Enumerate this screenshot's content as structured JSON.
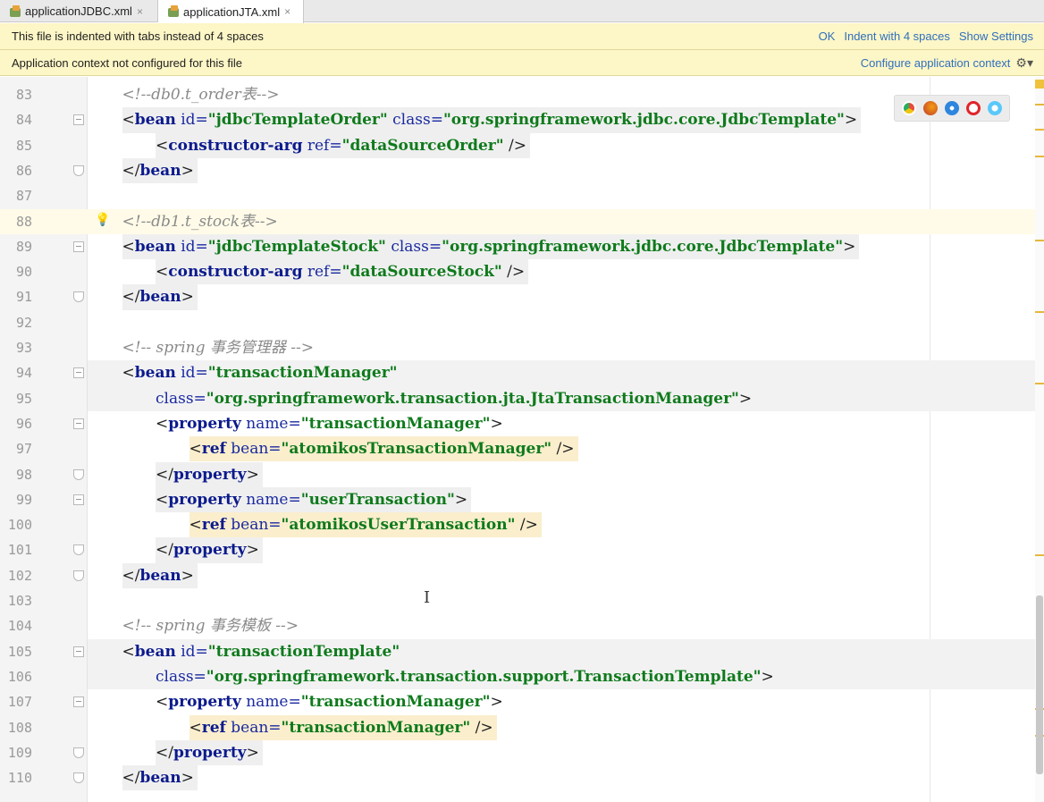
{
  "tabs": [
    {
      "label": "applicationJDBC.xml",
      "close": "×"
    },
    {
      "label": "applicationJTA.xml",
      "close": "×"
    }
  ],
  "banners": {
    "indent": {
      "message": "This file is indented with tabs instead of 4 spaces",
      "ok": "OK",
      "indent": "Indent with 4 spaces",
      "settings": "Show Settings"
    },
    "context": {
      "message": "Application context not configured for this file",
      "configure": "Configure application context",
      "gear": "⚙▾"
    }
  },
  "editor": {
    "lines": [
      {
        "n": "83",
        "tokens": [
          {
            "t": "cmt",
            "v": "<!--db0.t_order表-->"
          }
        ],
        "indent": 1
      },
      {
        "n": "84",
        "tokens": [
          {
            "t": "pun",
            "v": "<"
          },
          {
            "t": "tag",
            "v": "bean"
          },
          {
            "t": "attr",
            "v": " id="
          },
          {
            "t": "val",
            "v": "\"jdbcTemplateOrder\""
          },
          {
            "t": "attr",
            "v": " class="
          },
          {
            "t": "val",
            "v": "\"org.springframework.jdbc.core.JdbcTemplate\""
          },
          {
            "t": "pun",
            "v": ">"
          }
        ],
        "indent": 1,
        "hl": true,
        "fold": "open"
      },
      {
        "n": "85",
        "tokens": [
          {
            "t": "pun",
            "v": "<"
          },
          {
            "t": "tag",
            "v": "constructor-arg"
          },
          {
            "t": "attr",
            "v": " ref="
          },
          {
            "t": "val",
            "v": "\"dataSourceOrder\""
          },
          {
            "t": "pun",
            "v": " />"
          }
        ],
        "indent": 2,
        "hl": true
      },
      {
        "n": "86",
        "tokens": [
          {
            "t": "pun",
            "v": "</"
          },
          {
            "t": "tag",
            "v": "bean"
          },
          {
            "t": "pun",
            "v": ">"
          }
        ],
        "indent": 1,
        "hl": true,
        "fold": "close"
      },
      {
        "n": "87",
        "tokens": [],
        "indent": 1
      },
      {
        "n": "88",
        "tokens": [
          {
            "t": "cmt",
            "v": "<!--db1.t_stock表-->"
          }
        ],
        "indent": 1,
        "caret": true,
        "bulb": "💡"
      },
      {
        "n": "89",
        "tokens": [
          {
            "t": "pun",
            "v": "<"
          },
          {
            "t": "tag",
            "v": "bean"
          },
          {
            "t": "attr",
            "v": " id="
          },
          {
            "t": "val",
            "v": "\"jdbcTemplateStock\""
          },
          {
            "t": "attr",
            "v": " class="
          },
          {
            "t": "val",
            "v": "\"org.springframework.jdbc.core.JdbcTemplate\""
          },
          {
            "t": "pun",
            "v": ">"
          }
        ],
        "indent": 1,
        "hl": true,
        "fold": "open"
      },
      {
        "n": "90",
        "tokens": [
          {
            "t": "pun",
            "v": "<"
          },
          {
            "t": "tag",
            "v": "constructor-arg"
          },
          {
            "t": "attr",
            "v": " ref="
          },
          {
            "t": "val",
            "v": "\"dataSourceStock\""
          },
          {
            "t": "pun",
            "v": " />"
          }
        ],
        "indent": 2,
        "hl": true
      },
      {
        "n": "91",
        "tokens": [
          {
            "t": "pun",
            "v": "</"
          },
          {
            "t": "tag",
            "v": "bean"
          },
          {
            "t": "pun",
            "v": ">"
          }
        ],
        "indent": 1,
        "hl": true,
        "fold": "close"
      },
      {
        "n": "92",
        "tokens": [],
        "indent": 1
      },
      {
        "n": "93",
        "tokens": [
          {
            "t": "cmt",
            "v": "<!-- spring 事务管理器 -->"
          }
        ],
        "indent": 1
      },
      {
        "n": "94",
        "tokens": [
          {
            "t": "pun",
            "v": "<"
          },
          {
            "t": "tag",
            "v": "bean"
          },
          {
            "t": "attr",
            "v": " id="
          },
          {
            "t": "val",
            "v": "\"transactionManager\""
          }
        ],
        "indent": 1,
        "band": true,
        "fold": "open"
      },
      {
        "n": "95",
        "tokens": [
          {
            "t": "attr",
            "v": "class="
          },
          {
            "t": "val",
            "v": "\"org.springframework.transaction.jta.JtaTransactionManager\""
          },
          {
            "t": "pun",
            "v": ">"
          }
        ],
        "indent": 2,
        "band": true
      },
      {
        "n": "96",
        "tokens": [
          {
            "t": "pun",
            "v": "<"
          },
          {
            "t": "tag",
            "v": "property"
          },
          {
            "t": "attr",
            "v": " name="
          },
          {
            "t": "val",
            "v": "\"transactionManager\""
          },
          {
            "t": "pun",
            "v": ">"
          }
        ],
        "indent": 2,
        "fold": "open"
      },
      {
        "n": "97",
        "tokens": [
          {
            "t": "pun",
            "v": "<"
          },
          {
            "t": "tag",
            "v": "ref"
          },
          {
            "t": "attr",
            "v": " bean="
          },
          {
            "t": "val",
            "v": "\"atomikosTransactionManager\""
          },
          {
            "t": "pun",
            "v": " />"
          }
        ],
        "indent": 3,
        "ref": true
      },
      {
        "n": "98",
        "tokens": [
          {
            "t": "pun",
            "v": "</"
          },
          {
            "t": "tag",
            "v": "property"
          },
          {
            "t": "pun",
            "v": ">"
          }
        ],
        "indent": 2,
        "hl": true,
        "fold": "close"
      },
      {
        "n": "99",
        "tokens": [
          {
            "t": "pun",
            "v": "<"
          },
          {
            "t": "tag",
            "v": "property"
          },
          {
            "t": "attr",
            "v": " name="
          },
          {
            "t": "val",
            "v": "\"userTransaction\""
          },
          {
            "t": "pun",
            "v": ">"
          }
        ],
        "indent": 2,
        "hl": true,
        "fold": "open"
      },
      {
        "n": "100",
        "tokens": [
          {
            "t": "pun",
            "v": "<"
          },
          {
            "t": "tag",
            "v": "ref"
          },
          {
            "t": "attr",
            "v": " bean="
          },
          {
            "t": "val",
            "v": "\"atomikosUserTransaction\""
          },
          {
            "t": "pun",
            "v": " />"
          }
        ],
        "indent": 3,
        "ref": true
      },
      {
        "n": "101",
        "tokens": [
          {
            "t": "pun",
            "v": "</"
          },
          {
            "t": "tag",
            "v": "property"
          },
          {
            "t": "pun",
            "v": ">"
          }
        ],
        "indent": 2,
        "hl": true,
        "fold": "close"
      },
      {
        "n": "102",
        "tokens": [
          {
            "t": "pun",
            "v": "</"
          },
          {
            "t": "tag",
            "v": "bean"
          },
          {
            "t": "pun",
            "v": ">"
          }
        ],
        "indent": 1,
        "hl": true,
        "fold": "close"
      },
      {
        "n": "103",
        "tokens": [],
        "indent": 1
      },
      {
        "n": "104",
        "tokens": [
          {
            "t": "cmt",
            "v": "<!-- spring 事务模板 -->"
          }
        ],
        "indent": 1
      },
      {
        "n": "105",
        "tokens": [
          {
            "t": "pun",
            "v": "<"
          },
          {
            "t": "tag",
            "v": "bean"
          },
          {
            "t": "attr",
            "v": " id="
          },
          {
            "t": "val",
            "v": "\"transactionTemplate\""
          }
        ],
        "indent": 1,
        "band": true,
        "fold": "open"
      },
      {
        "n": "106",
        "tokens": [
          {
            "t": "attr",
            "v": "class="
          },
          {
            "t": "val",
            "v": "\"org.springframework.transaction.support.TransactionTemplate\""
          },
          {
            "t": "pun",
            "v": ">"
          }
        ],
        "indent": 2,
        "band": true
      },
      {
        "n": "107",
        "tokens": [
          {
            "t": "pun",
            "v": "<"
          },
          {
            "t": "tag",
            "v": "property"
          },
          {
            "t": "attr",
            "v": " name="
          },
          {
            "t": "val",
            "v": "\"transactionManager\""
          },
          {
            "t": "pun",
            "v": ">"
          }
        ],
        "indent": 2,
        "fold": "open"
      },
      {
        "n": "108",
        "tokens": [
          {
            "t": "pun",
            "v": "<"
          },
          {
            "t": "tag",
            "v": "ref"
          },
          {
            "t": "attr",
            "v": " bean="
          },
          {
            "t": "val",
            "v": "\"transactionManager\""
          },
          {
            "t": "pun",
            "v": " />"
          }
        ],
        "indent": 3,
        "ref": true
      },
      {
        "n": "109",
        "tokens": [
          {
            "t": "pun",
            "v": "</"
          },
          {
            "t": "tag",
            "v": "property"
          },
          {
            "t": "pun",
            "v": ">"
          }
        ],
        "indent": 2,
        "hl": true,
        "fold": "close"
      },
      {
        "n": "110",
        "tokens": [
          {
            "t": "pun",
            "v": "</"
          },
          {
            "t": "tag",
            "v": "bean"
          },
          {
            "t": "pun",
            "v": ">"
          }
        ],
        "indent": 1,
        "hl": true,
        "fold": "close"
      }
    ]
  },
  "browser_icons": [
    "chrome-icon",
    "firefox-icon",
    "safari-icon",
    "opera-icon",
    "ie-icon"
  ],
  "colors": {
    "tag": "#0b1a8c",
    "value": "#0f7a1c",
    "comment": "#8a8a8a",
    "banner": "#fdf6c6",
    "link": "#2f6fbd"
  }
}
